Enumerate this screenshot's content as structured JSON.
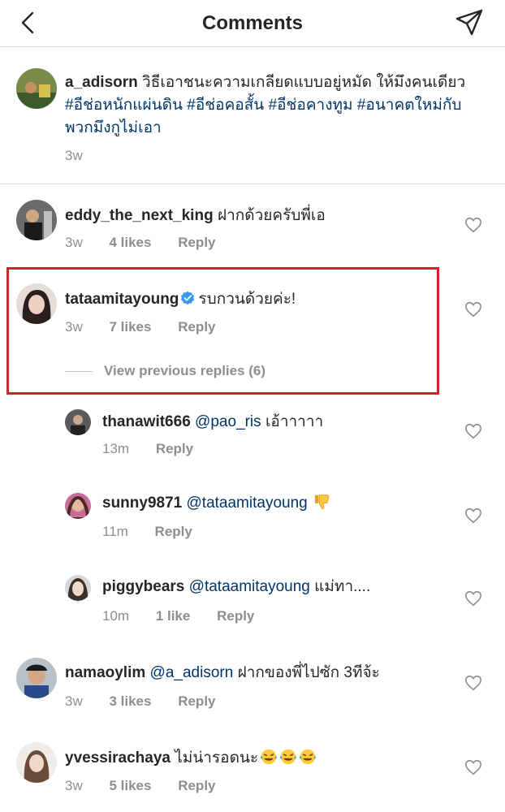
{
  "header": {
    "title": "Comments"
  },
  "caption": {
    "username": "a_adisorn",
    "text": "วิธีเอาชนะความเกลียดแบบอยู่หมัด ให้มึงคนเดียว",
    "hashtags": [
      "#อีช่อหนักแผ่นดิน",
      "#อีช่อคอสั้น",
      "#อีช่อคางทูม",
      "#อนาคตใหม่กับพวกมึงกูไม่เอา"
    ],
    "time": "3w"
  },
  "comments": [
    {
      "username": "eddy_the_next_king",
      "text": "ฝากด้วยครับพี่เอ",
      "time": "3w",
      "likes": "4 likes",
      "reply": "Reply"
    },
    {
      "username": "tataamitayoung",
      "verified": true,
      "text": "รบกวนด้วยค่ะ!",
      "time": "3w",
      "likes": "7 likes",
      "reply": "Reply",
      "view_previous": "View previous replies (6)"
    },
    {
      "username": "namaoylim",
      "mention": "@a_adisorn",
      "text": "ฝากของพี่ไปซัก 3ทีจ้ะ",
      "time": "3w",
      "likes": "3 likes",
      "reply": "Reply"
    },
    {
      "username": "yvessirachaya",
      "text": "ไม่น่ารอดนะ",
      "emoji": "face-with-tears-of-joy-icon",
      "time": "3w",
      "likes": "5 likes",
      "reply": "Reply"
    }
  ],
  "replies": [
    {
      "username": "thanawit666",
      "mention": "@pao_ris",
      "text": "เอ้าาาาา",
      "time": "13m",
      "reply": "Reply"
    },
    {
      "username": "sunny9871",
      "mention": "@tataamitayoung",
      "emoji": "thumbs-down-icon",
      "time": "11m",
      "reply": "Reply"
    },
    {
      "username": "piggybears",
      "mention": "@tataamitayoung",
      "text": "แม่ทา....",
      "time": "10m",
      "likes": "1 like",
      "reply": "Reply"
    }
  ],
  "colors": {
    "link": "#003569",
    "meta": "#8e8e8e",
    "highlight": "#d0262b",
    "verified": "#3897f0"
  }
}
